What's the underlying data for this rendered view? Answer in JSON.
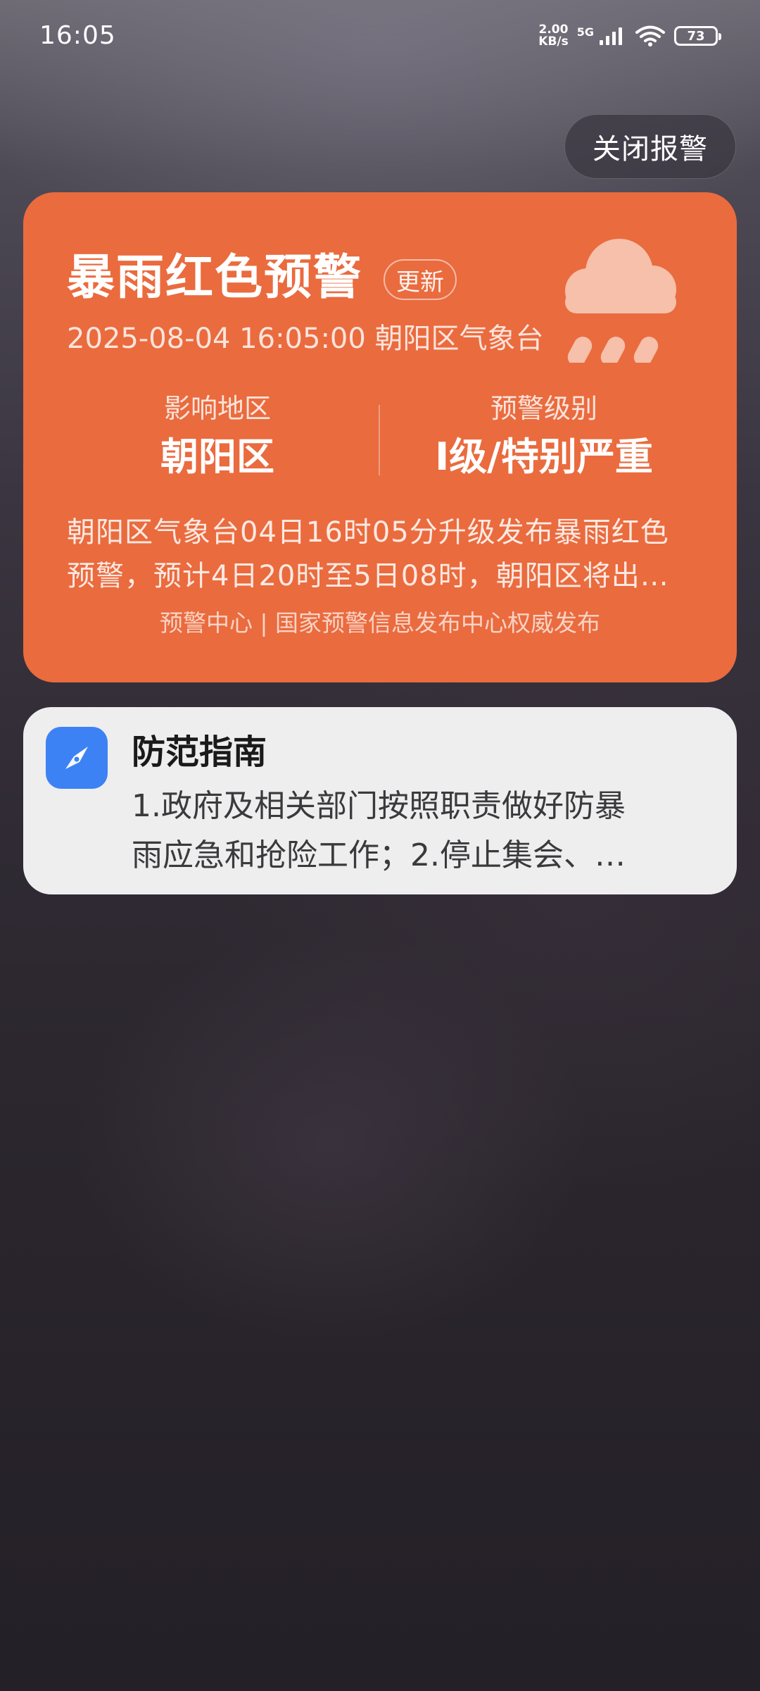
{
  "status_bar": {
    "time": "16:05",
    "net_speed_value": "2.00",
    "net_speed_unit": "KB/s",
    "network_type": "5G",
    "battery_level": "73",
    "icons": [
      "signal-icon",
      "wifi-icon",
      "battery-icon"
    ]
  },
  "close_alarm_button": {
    "label": "关闭报警"
  },
  "alert": {
    "title": "暴雨红色预警",
    "update_badge": "更新",
    "meta": "2025-08-04 16:05:00 朝阳区气象台",
    "icon": "heavy-rain-icon",
    "area_label": "影响地区",
    "area_value": "朝阳区",
    "level_label": "预警级别",
    "level_value": "I级/特别严重",
    "description_line1": "朝阳区气象台04日16时05分升级发布暴雨红色",
    "description_line2": "预警，预计4日20时至5日08时，朝阳区将出…",
    "source": "预警中心 | 国家预警信息发布中心权威发布",
    "colors": {
      "card_background": "#ea6b3e"
    }
  },
  "guide": {
    "icon": "compass-icon",
    "title": "防范指南",
    "body_line1": "1.政府及相关部门按照职责做好防暴",
    "body_line2": "雨应急和抢险工作；2.停止集会、…",
    "colors": {
      "icon_background": "#3d82f5",
      "card_background": "#eeeeef"
    }
  }
}
